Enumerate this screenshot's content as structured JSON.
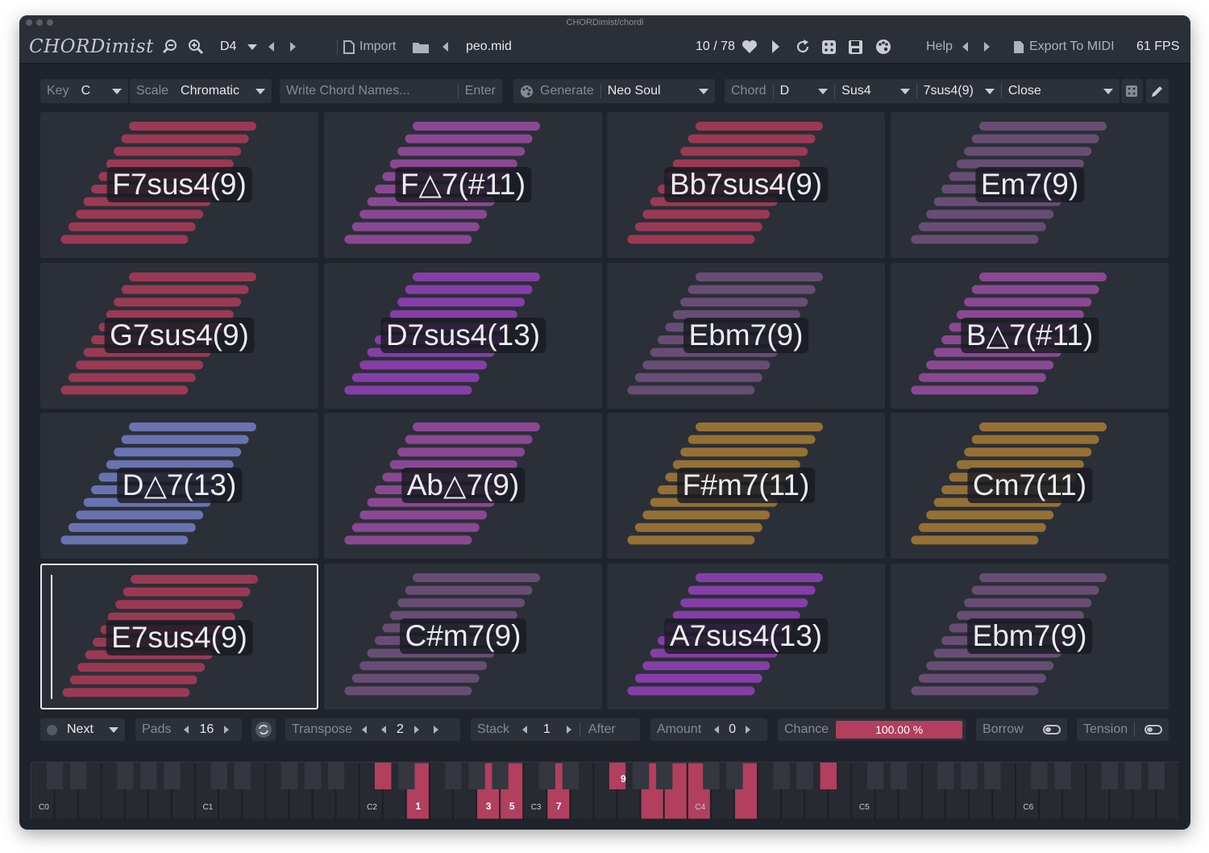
{
  "window": {
    "title": "CHORDimist/chordi"
  },
  "toolbar": {
    "logo": "CHORDimist",
    "octave": "D4",
    "import_label": "Import",
    "file_name": "peo.mid",
    "counter": "10 / 78",
    "help_label": "Help",
    "export_label": "Export To MIDI",
    "fps": "61 FPS"
  },
  "controls": {
    "key_label": "Key",
    "key_value": "C",
    "scale_label": "Scale",
    "scale_value": "Chromatic",
    "chord_input_placeholder": "Write Chord Names...",
    "enter_label": "Enter",
    "generate_label": "Generate",
    "style_value": "Neo Soul",
    "chord_label": "Chord",
    "chord_root": "D",
    "chord_type": "Sus4",
    "chord_ext": "7sus4(9)",
    "voicing": "Close"
  },
  "colors": {
    "crimson": "#a03a55",
    "magenta": "#8f4a98",
    "mauve": "#6a4f77",
    "purple": "#8a3fae",
    "blue": "#6b77b5",
    "gold": "#9a7435",
    "selected_border": "#e8e8ec"
  },
  "pads": [
    {
      "label": "F7sus4(9)",
      "color": "crimson"
    },
    {
      "label": "F△7(#11)",
      "color": "magenta"
    },
    {
      "label": "Bb7sus4(9)",
      "color": "crimson"
    },
    {
      "label": "Em7(9)",
      "color": "mauve"
    },
    {
      "label": "G7sus4(9)",
      "color": "crimson"
    },
    {
      "label": "D7sus4(13)",
      "color": "purple"
    },
    {
      "label": "Ebm7(9)",
      "color": "mauve"
    },
    {
      "label": "B△7(#11)",
      "color": "magenta"
    },
    {
      "label": "D△7(13)",
      "color": "blue"
    },
    {
      "label": "Ab△7(9)",
      "color": "magenta"
    },
    {
      "label": "F#m7(11)",
      "color": "gold"
    },
    {
      "label": "Cm7(11)",
      "color": "gold"
    },
    {
      "label": "E7sus4(9)",
      "color": "crimson",
      "selected": true
    },
    {
      "label": "C#m7(9)",
      "color": "mauve"
    },
    {
      "label": "A7sus4(13)",
      "color": "purple"
    },
    {
      "label": "Ebm7(9)",
      "color": "mauve"
    }
  ],
  "bottom": {
    "mode": "Next",
    "pads_label": "Pads",
    "pads_value": "16",
    "transpose_label": "Transpose",
    "transpose_value": "2",
    "stack_label": "Stack",
    "stack_value": "1",
    "after_label": "After",
    "amount_label": "Amount",
    "amount_value": "0",
    "chance_label": "Chance",
    "chance_value": "100.00 %",
    "chance_fraction": 1.0,
    "borrow_label": "Borrow",
    "tension_label": "Tension"
  },
  "keyboard": {
    "octave_labels": [
      "C0",
      "C1",
      "C2",
      "C3",
      "C4",
      "C5",
      "C6"
    ],
    "degree_labels": [
      "1",
      "3",
      "5",
      "7",
      "9"
    ],
    "active_color": "#b23f5e"
  }
}
